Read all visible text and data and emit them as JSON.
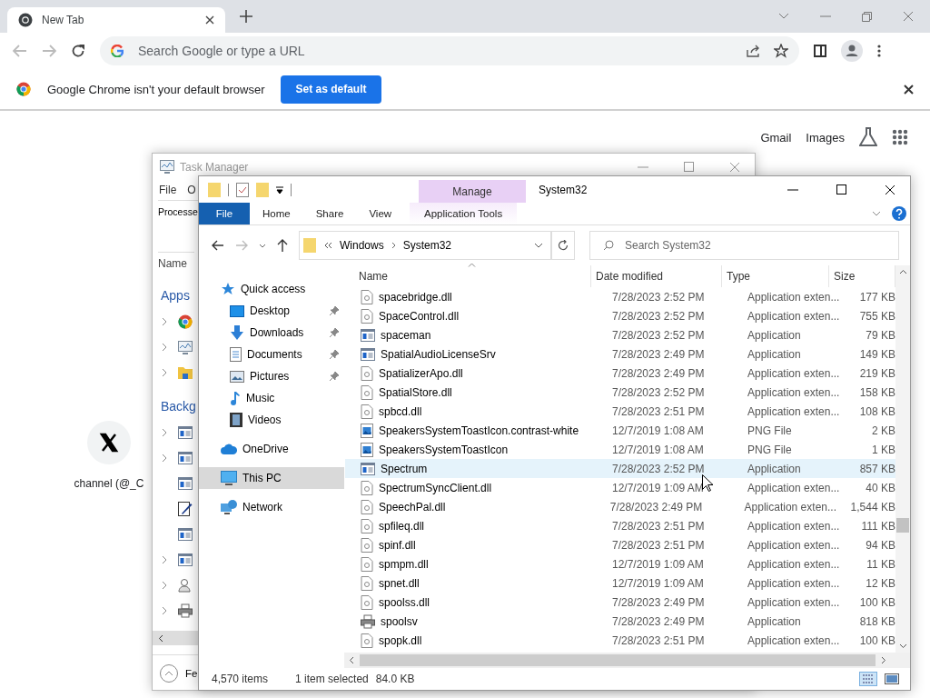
{
  "browser": {
    "tab": {
      "title": "New Tab"
    },
    "omnibox": {
      "placeholder": "Search Google or type a URL"
    },
    "infobar": {
      "message": "Google Chrome isn't your default browser",
      "button": "Set as default"
    },
    "header_links": [
      "Gmail",
      "Images"
    ],
    "shortcuts": [
      {
        "label": "channel (@_C"
      }
    ]
  },
  "task_manager": {
    "title": "Task Manager",
    "menu": [
      "File",
      "O"
    ],
    "tab": "Processe",
    "column": "Name",
    "sections": [
      {
        "heading": "Apps",
        "rows": [
          {
            "kind": "browser",
            "expandable": true
          },
          {
            "kind": "monitor",
            "expandable": true
          },
          {
            "kind": "folder",
            "expandable": true
          }
        ]
      },
      {
        "heading": "Backg",
        "rows": [
          {
            "kind": "app",
            "expandable": true
          },
          {
            "kind": "app",
            "expandable": true
          },
          {
            "kind": "app",
            "expandable": false
          },
          {
            "kind": "notepad",
            "expandable": false
          },
          {
            "kind": "app",
            "expandable": false
          },
          {
            "kind": "app",
            "expandable": true
          },
          {
            "kind": "user",
            "expandable": true
          },
          {
            "kind": "printer",
            "expandable": true
          }
        ]
      }
    ],
    "footer": "Fe"
  },
  "explorer": {
    "title": "System32",
    "context_group": "Manage",
    "ribbon_tabs": [
      {
        "label": "File",
        "kind": "file"
      },
      {
        "label": "Home",
        "kind": "normal"
      },
      {
        "label": "Share",
        "kind": "normal"
      },
      {
        "label": "View",
        "kind": "normal"
      },
      {
        "label": "Application Tools",
        "kind": "context"
      }
    ],
    "breadcrumb": [
      "Windows",
      "System32"
    ],
    "search": {
      "placeholder": "Search System32"
    },
    "nav": [
      {
        "label": "Quick access",
        "kind": "star",
        "selected": false,
        "children": [
          {
            "label": "Desktop",
            "kind": "desktop",
            "pinned": true,
            "selected": false
          },
          {
            "label": "Downloads",
            "kind": "downloads",
            "pinned": true,
            "selected": false
          },
          {
            "label": "Documents",
            "kind": "documents",
            "pinned": true,
            "selected": false
          },
          {
            "label": "Pictures",
            "kind": "pictures",
            "pinned": true,
            "selected": false
          },
          {
            "label": "Music",
            "kind": "music",
            "pinned": false,
            "selected": false
          },
          {
            "label": "Videos",
            "kind": "videos",
            "pinned": false,
            "selected": false
          }
        ]
      },
      {
        "label": "OneDrive",
        "kind": "cloud",
        "selected": false
      },
      {
        "label": "This PC",
        "kind": "pc",
        "selected": true
      },
      {
        "label": "Network",
        "kind": "network",
        "selected": false
      }
    ],
    "columns": [
      "Name",
      "Date modified",
      "Type",
      "Size"
    ],
    "rows": [
      {
        "name": "spacebridge.dll",
        "date": "7/28/2023 2:52 PM",
        "type": "Application exten...",
        "size": "177 KB",
        "kind": "dll",
        "selected": false
      },
      {
        "name": "SpaceControl.dll",
        "date": "7/28/2023 2:52 PM",
        "type": "Application exten...",
        "size": "755 KB",
        "kind": "dll",
        "selected": false
      },
      {
        "name": "spaceman",
        "date": "7/28/2023 2:52 PM",
        "type": "Application",
        "size": "79 KB",
        "kind": "app",
        "selected": false
      },
      {
        "name": "SpatialAudioLicenseSrv",
        "date": "7/28/2023 2:49 PM",
        "type": "Application",
        "size": "149 KB",
        "kind": "app",
        "selected": false
      },
      {
        "name": "SpatializerApo.dll",
        "date": "7/28/2023 2:49 PM",
        "type": "Application exten...",
        "size": "219 KB",
        "kind": "dll",
        "selected": false
      },
      {
        "name": "SpatialStore.dll",
        "date": "7/28/2023 2:52 PM",
        "type": "Application exten...",
        "size": "158 KB",
        "kind": "dll",
        "selected": false
      },
      {
        "name": "spbcd.dll",
        "date": "7/28/2023 2:51 PM",
        "type": "Application exten...",
        "size": "108 KB",
        "kind": "dll",
        "selected": false
      },
      {
        "name": "SpeakersSystemToastIcon.contrast-white",
        "date": "12/7/2019 1:08 AM",
        "type": "PNG File",
        "size": "2 KB",
        "kind": "png",
        "selected": false
      },
      {
        "name": "SpeakersSystemToastIcon",
        "date": "12/7/2019 1:08 AM",
        "type": "PNG File",
        "size": "1 KB",
        "kind": "png",
        "selected": false
      },
      {
        "name": "Spectrum",
        "date": "7/28/2023 2:52 PM",
        "type": "Application",
        "size": "857 KB",
        "kind": "app",
        "selected": true
      },
      {
        "name": "SpectrumSyncClient.dll",
        "date": "12/7/2019 1:09 AM",
        "type": "Application exten...",
        "size": "40 KB",
        "kind": "dll",
        "selected": false
      },
      {
        "name": "SpeechPal.dll",
        "date": "7/28/2023 2:49 PM",
        "type": "Application exten...",
        "size": "1,544 KB",
        "kind": "dll",
        "selected": false
      },
      {
        "name": "spfileq.dll",
        "date": "7/28/2023 2:51 PM",
        "type": "Application exten...",
        "size": "111 KB",
        "kind": "dll",
        "selected": false
      },
      {
        "name": "spinf.dll",
        "date": "7/28/2023 2:51 PM",
        "type": "Application exten...",
        "size": "94 KB",
        "kind": "dll",
        "selected": false
      },
      {
        "name": "spmpm.dll",
        "date": "12/7/2019 1:09 AM",
        "type": "Application exten...",
        "size": "11 KB",
        "kind": "dll",
        "selected": false
      },
      {
        "name": "spnet.dll",
        "date": "12/7/2019 1:09 AM",
        "type": "Application exten...",
        "size": "12 KB",
        "kind": "dll",
        "selected": false
      },
      {
        "name": "spoolss.dll",
        "date": "7/28/2023 2:49 PM",
        "type": "Application exten...",
        "size": "100 KB",
        "kind": "dll",
        "selected": false
      },
      {
        "name": "spoolsv",
        "date": "7/28/2023 2:49 PM",
        "type": "Application",
        "size": "818 KB",
        "kind": "printer",
        "selected": false
      },
      {
        "name": "spopk.dll",
        "date": "7/28/2023 2:51 PM",
        "type": "Application exten...",
        "size": "100 KB",
        "kind": "dll",
        "selected": false
      }
    ],
    "status": {
      "count": "4,570 items",
      "selection": "1 item selected",
      "size": "84.0 KB"
    }
  }
}
